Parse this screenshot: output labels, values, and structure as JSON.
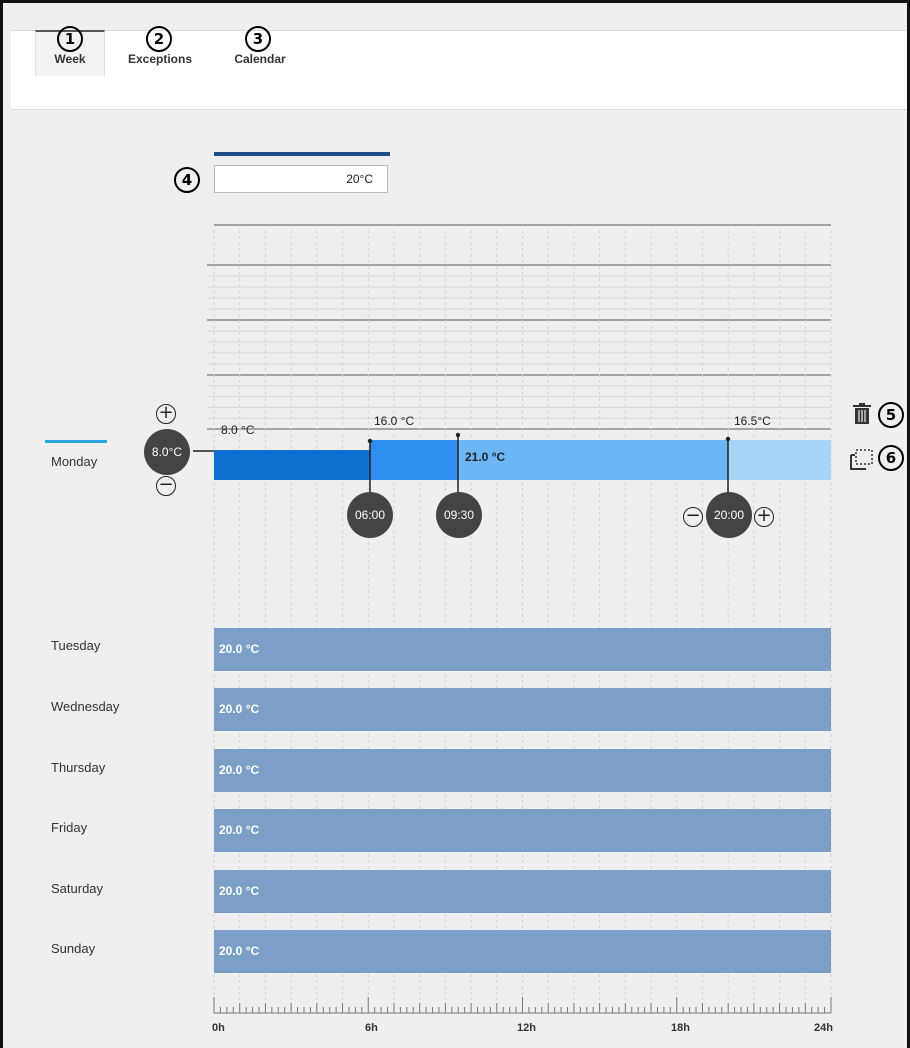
{
  "tabs": [
    {
      "label": "Week",
      "callout": "1"
    },
    {
      "label": "Exceptions",
      "callout": "2"
    },
    {
      "label": "Calendar",
      "callout": "3"
    }
  ],
  "temperature_input": {
    "value": "20°C",
    "callout": "4"
  },
  "monday": {
    "label": "Monday",
    "start_temp": "8.0°C",
    "segment_labels": [
      "8.0 °C",
      "16.0 °C",
      "21.0 °C",
      "16.5°C"
    ],
    "switch_times": [
      "06:00",
      "09:30",
      "20:00"
    ],
    "colors": [
      "#0e6fd3",
      "#2e8ff0",
      "#6cb6f7",
      "#a8d2f8"
    ]
  },
  "actions": [
    {
      "name": "delete",
      "icon": "trash-icon",
      "callout": "5"
    },
    {
      "name": "copy",
      "icon": "copy-icon",
      "callout": "6"
    }
  ],
  "days": [
    {
      "label": "Tuesday",
      "temp": "20.0 °C"
    },
    {
      "label": "Wednesday",
      "temp": "20.0 °C"
    },
    {
      "label": "Thursday",
      "temp": "20.0 °C"
    },
    {
      "label": "Friday",
      "temp": "20.0 °C"
    },
    {
      "label": "Saturday",
      "temp": "20.0 °C"
    },
    {
      "label": "Sunday",
      "temp": "20.0 °C"
    }
  ],
  "time_axis": {
    "labels": [
      "0h",
      "6h",
      "12h",
      "18h",
      "24h"
    ]
  },
  "plus_symbol": "+",
  "minus_symbol": "−"
}
